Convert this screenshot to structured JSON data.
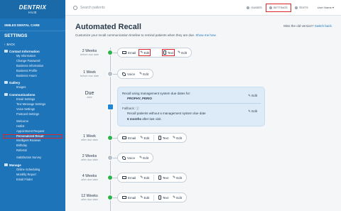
{
  "brand": {
    "logo_main": "DENTRIX",
    "logo_sub": "HUB"
  },
  "sidebar": {
    "practice": "SMILES DENTAL CARE",
    "heading": "SETTINGS",
    "back": "BACK",
    "sections": [
      {
        "label": "Contact Information",
        "items": [
          "My Information",
          "Change Password",
          "Business Information",
          "Business Profile",
          "Business Hours"
        ]
      },
      {
        "label": "Gallery",
        "items": [
          "Images"
        ]
      },
      {
        "label": "Communications",
        "items": [
          "Email Settings",
          "Text Message Settings",
          "Voice Settings",
          "Postcard Settings",
          "",
          "Welcome",
          "Hotlist",
          "Appointment Request",
          "Personalized Recall",
          "Intelligent Reviews",
          "Birthday",
          "Referral",
          "",
          "Satisfaction Survey"
        ]
      },
      {
        "label": "Manage",
        "items": [
          "Online Scheduling",
          "Monthly Report",
          "Email Finder"
        ]
      }
    ],
    "active_item": "Personalized Recall"
  },
  "topbar": {
    "search_placeholder": "Search patients",
    "nav": [
      {
        "label": "GUIDES",
        "icon": "book-icon"
      },
      {
        "label": "SETTINGS",
        "icon": "gear-icon"
      },
      {
        "label": "TEXTS",
        "icon": "chat-icon"
      }
    ],
    "user": "User Name"
  },
  "page": {
    "title": "Automated Recall",
    "description": "Customize your recall communication timeline to remind patients when they are due.",
    "show_me_how": "Show me how.",
    "miss_old": "Miss the old version?",
    "switch_back": "Switch back."
  },
  "timeline": {
    "rows": [
      {
        "when": "2 Weeks",
        "rel": "before due date",
        "status": "green",
        "channels": [
          {
            "name": "Email",
            "icon": "envelope-icon"
          },
          {
            "name": "Text",
            "icon": "mobile-icon"
          }
        ]
      },
      {
        "when": "1 Week",
        "rel": "before due date",
        "status": "gray",
        "channels": [
          {
            "name": "Voice",
            "icon": "phone-icon"
          }
        ]
      },
      {
        "when": "1 Week",
        "rel": "after due date",
        "status": "green",
        "channels": [
          {
            "name": "Email",
            "icon": "envelope-icon"
          },
          {
            "name": "Text",
            "icon": "mobile-icon"
          }
        ]
      },
      {
        "when": "2 Weeks",
        "rel": "after due date",
        "status": "gray",
        "channels": [
          {
            "name": "Voice",
            "icon": "phone-icon"
          }
        ]
      },
      {
        "when": "4 Weeks",
        "rel": "after due date",
        "status": "green",
        "channels": [
          {
            "name": "Email",
            "icon": "envelope-icon"
          },
          {
            "name": "Text",
            "icon": "mobile-icon"
          }
        ]
      },
      {
        "when": "12 Weeks",
        "rel": "after due date",
        "status": "green",
        "channels": [
          {
            "name": "Email",
            "icon": "envelope-icon"
          },
          {
            "name": "Text",
            "icon": "mobile-icon"
          }
        ]
      }
    ],
    "edit_label": "Edit",
    "due": {
      "label": "Due",
      "sub": "date",
      "line1": "Recall using management system due dates for:",
      "line2": "PROPHY, PERIO",
      "fallback": "Fallback:",
      "line3": "Recall patients without a management system due date",
      "line4_bold": "6 months",
      "line4_rest": "after last visit."
    }
  }
}
